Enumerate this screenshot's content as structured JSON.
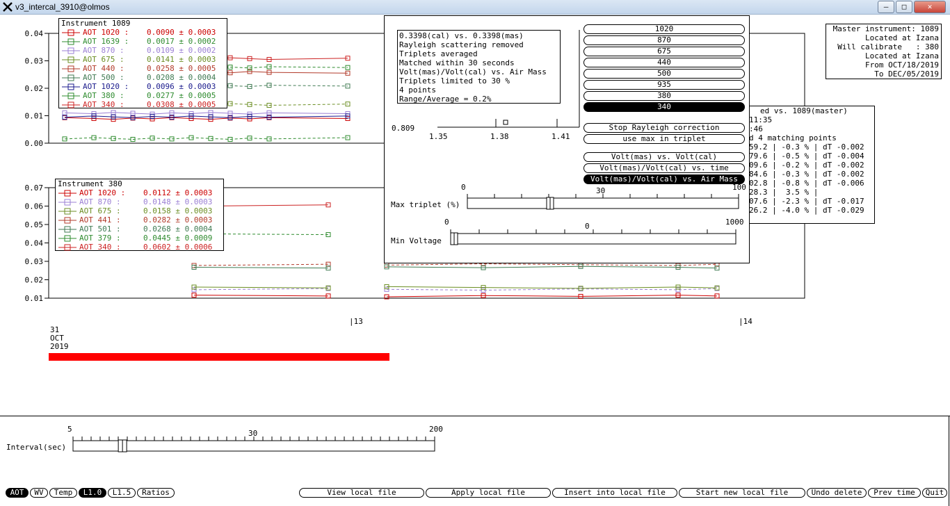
{
  "window": {
    "title": "v3_intercal_3910@olmos"
  },
  "chart1": {
    "ytick_labels": [
      "0.04",
      "0.03",
      "0.02",
      "0.01",
      "0.00"
    ],
    "legend_title": "Instrument 1089",
    "legend": [
      {
        "label": "AOT 1020 :",
        "value": "0.0090 ± 0.0003",
        "color": "#cc0000"
      },
      {
        "label": "AOT 1639 :",
        "value": "0.0017 ± 0.0002",
        "color": "#2e8b2e"
      },
      {
        "label": "AOT 870 :",
        "value": "0.0109 ± 0.0002",
        "color": "#9b7fd4"
      },
      {
        "label": "AOT 675 :",
        "value": "0.0141 ± 0.0003",
        "color": "#6b8e23"
      },
      {
        "label": "AOT 440 :",
        "value": "0.0258 ± 0.0005",
        "color": "#b23a2a"
      },
      {
        "label": "AOT 500 :",
        "value": "0.0208 ± 0.0004",
        "color": "#3f7a52"
      },
      {
        "label": "AOT 1020 :",
        "value": "0.0096 ± 0.0003",
        "color": "#1a1a8c"
      },
      {
        "label": "AOT 380 :",
        "value": "0.0277 ± 0.0005",
        "color": "#2e8b2e"
      },
      {
        "label": "AOT 340 :",
        "value": "0.0308 ± 0.0005",
        "color": "#cc2222"
      }
    ]
  },
  "chart2": {
    "ytick_labels": [
      "0.07",
      "0.06",
      "0.05",
      "0.04",
      "0.03",
      "0.02",
      "0.01"
    ],
    "legend_title": "Instrument 380",
    "legend": [
      {
        "label": "AOT 1020 :",
        "value": "0.0112 ± 0.0003",
        "color": "#cc0000"
      },
      {
        "label": "AOT 870 :",
        "value": "0.0148 ± 0.0003",
        "color": "#9b7fd4"
      },
      {
        "label": "AOT 675 :",
        "value": "0.0158 ± 0.0003",
        "color": "#6b8e23"
      },
      {
        "label": "AOT 441 :",
        "value": "0.0282 ± 0.0003",
        "color": "#b23a2a"
      },
      {
        "label": "AOT 501 :",
        "value": "0.0268 ± 0.0004",
        "color": "#3f7a52"
      },
      {
        "label": "AOT 379 :",
        "value": "0.0445 ± 0.0009",
        "color": "#2e8b2e"
      },
      {
        "label": "AOT 340 :",
        "value": "0.0602 ± 0.0006",
        "color": "#cc2222"
      }
    ]
  },
  "time_axis": {
    "tick13": "|13",
    "tick14": "|14",
    "date_day": "31",
    "date_month": "OCT",
    "date_year": "2019"
  },
  "master_info": [
    "Master instrument: 1089",
    "Located at Izana",
    "Will calibrate   : 380",
    "Located at Izana",
    "From OCT/18/2019",
    "To DEC/05/2019"
  ],
  "ratio_panel": {
    "header": "ed vs. 1089(master)",
    "lines": [
      "11:35",
      ":46",
      "d 4 matching points",
      "59.2 | -0.3 % | dT -0.002",
      "79.6 | -0.5 % | dT -0.004",
      "09.6 | -0.2 % | dT -0.002",
      "84.6 | -0.3 % | dT -0.002",
      "02.8 | -0.8 % | dT -0.006",
      "28.3 |  3.5 % |",
      "07.6 | -2.3 % | dT -0.017",
      "26.2 | -4.0 % | dT -0.029"
    ]
  },
  "popup": {
    "info_lines": [
      "0.3398(cal) vs. 0.3398(mas)",
      "Rayleigh scattering removed",
      "Triplets averaged",
      "Matched within 30 seconds",
      "Volt(mas)/Volt(cal) vs. Air Mass",
      "Triplets limited to 30 %",
      "4 points",
      "Range/Average = 0.2%"
    ],
    "mini_y": "0.809",
    "mini_x": [
      "1.35",
      "1.38",
      "1.41"
    ],
    "wavelength_buttons": [
      "1020",
      "870",
      "675",
      "440",
      "500",
      "935",
      "380",
      "340"
    ],
    "selected_wavelength": "340",
    "rayleigh_button": "Stop Rayleigh correction",
    "max_triplet_button": "use max in triplet",
    "plot_buttons": [
      "Volt(mas) vs. Volt(cal)",
      "Volt(mas)/Volt(cal) vs. time",
      "Volt(mas)/Volt(cal) vs. Air Mass"
    ],
    "selected_plot": "Volt(mas)/Volt(cal) vs. Air Mass",
    "max_triplet": {
      "label": "Max triplet (%)",
      "min": "0",
      "mid": "30",
      "max": "100",
      "value": 30
    },
    "min_voltage": {
      "label": "Min Voltage",
      "min": "0",
      "mid": "0",
      "max": "1000",
      "value": 0
    }
  },
  "interval": {
    "label": "Interval(sec)",
    "min": "5",
    "mid": "30",
    "max": "200",
    "value": 30
  },
  "bottom_toggles": [
    {
      "label": "AOT",
      "active": true
    },
    {
      "label": "WV",
      "active": false
    },
    {
      "label": "Temp",
      "active": false
    },
    {
      "label": "L1.0",
      "active": true
    },
    {
      "label": "L1.5",
      "active": false
    },
    {
      "label": "Ratios",
      "active": false
    }
  ],
  "bottom_actions": [
    "View local file",
    "Apply local file",
    "Insert into local file",
    "Start new local file",
    "Undo delete",
    "Prev time",
    "Quit"
  ]
}
